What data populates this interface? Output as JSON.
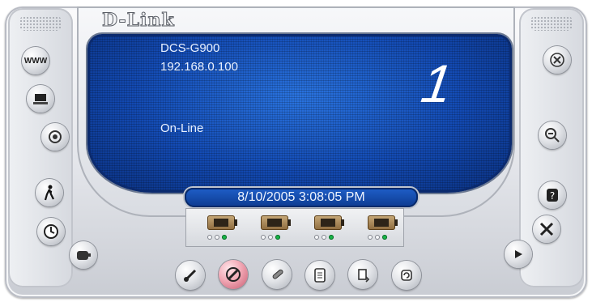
{
  "brand": {
    "logo_text": "D-Link"
  },
  "display": {
    "camera_model": "DCS-G900",
    "ip_address": "192.168.0.100",
    "status": "On-Line",
    "channel_number": "1"
  },
  "datetime": "8/10/2005 3:08:05 PM",
  "colors": {
    "screen_blue": "#134ab3",
    "status_green": "#19b548",
    "record_pink": "#f1a7b4"
  },
  "left_buttons": [
    {
      "id": "web",
      "label": "WWW",
      "icon": "www-icon"
    },
    {
      "id": "snapshot",
      "icon": "monitor-icon"
    },
    {
      "id": "record",
      "icon": "target-icon"
    },
    {
      "id": "motion",
      "icon": "walking-person-icon"
    },
    {
      "id": "schedule",
      "icon": "clock-icon"
    },
    {
      "id": "ptz",
      "icon": "hand-icon"
    }
  ],
  "right_buttons": [
    {
      "id": "close",
      "icon": "close-icon"
    },
    {
      "id": "zoom",
      "icon": "zoom-out-icon"
    },
    {
      "id": "help",
      "icon": "help-icon"
    },
    {
      "id": "settings",
      "icon": "tools-icon"
    },
    {
      "id": "play",
      "icon": "play-icon"
    }
  ],
  "bottom_buttons": [
    {
      "id": "connect",
      "icon": "plug-icon"
    },
    {
      "id": "disconnect",
      "icon": "no-plug-icon"
    },
    {
      "id": "edit",
      "icon": "pencil-icon"
    },
    {
      "id": "log",
      "icon": "clipboard-icon"
    },
    {
      "id": "switch",
      "icon": "rotate-icon"
    },
    {
      "id": "refresh",
      "icon": "refresh-icon"
    }
  ],
  "cameras": [
    {
      "slot": "1",
      "lights": [
        "off",
        "off",
        "on"
      ]
    },
    {
      "slot": "2",
      "lights": [
        "off",
        "off",
        "on"
      ]
    },
    {
      "slot": "3",
      "lights": [
        "off",
        "off",
        "on"
      ]
    },
    {
      "slot": "4",
      "lights": [
        "off",
        "off",
        "on"
      ]
    }
  ]
}
